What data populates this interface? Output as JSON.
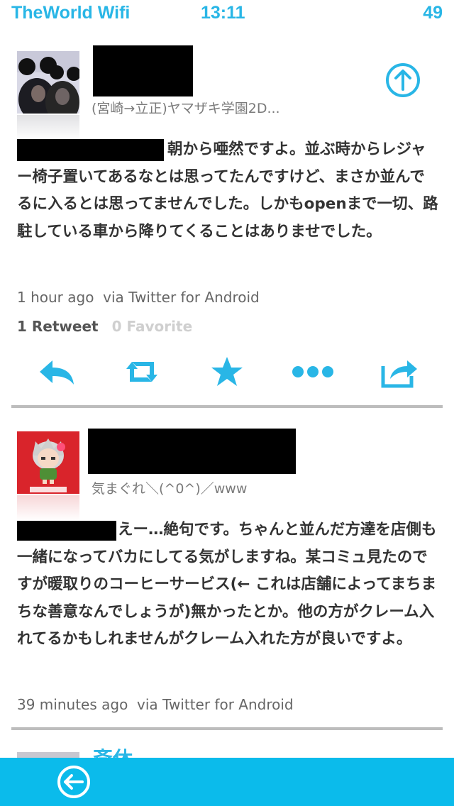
{
  "status_bar": {
    "carrier": "TheWorld Wifi",
    "time": "13:11",
    "battery": "49"
  },
  "tweets": [
    {
      "subline": "(宮崎→立正)ヤマザキ学園2D...",
      "body": "朝から唖然ですよ。並ぶ時からレジャー椅子置いてあるなとは思ってたんですけど、まさか並んでるに入るとは思ってませんでした。しかもopenまで一切、路駐している車から降りてくることはありませでした。",
      "time_ago": "1 hour ago",
      "via": "via Twitter for Android",
      "retweets": "1 Retweet",
      "favorites": "0 Favorite"
    },
    {
      "subline": "気まぐれ＼(^0^)／www",
      "body": "えー…絶句です。ちゃんと並んだ方達を店側も一緒になってバカにしてる気がしますね。某コミュ見たのですが暖取りのコーヒーサービス(← これは店舗によってまちまちな善意なんでしょうが)無かったとか。他の方がクレーム入れてるかもしれませんがクレーム入れた方が良いですよ。",
      "time_ago": "39 minutes ago",
      "via": "via Twitter for Android"
    }
  ],
  "next_tweet_partial_name": "斎休",
  "icons": {
    "reply": "reply-icon",
    "retweet": "retweet-icon",
    "favorite": "star-icon",
    "more": "more-icon",
    "share": "share-icon",
    "up": "arrow-up-circle-icon",
    "back": "arrow-left-circle-icon"
  },
  "colors": {
    "accent": "#29b6e6",
    "bottom_bar": "#0bbbeb",
    "divider": "#bdbdbd",
    "redaction": "#000000"
  }
}
